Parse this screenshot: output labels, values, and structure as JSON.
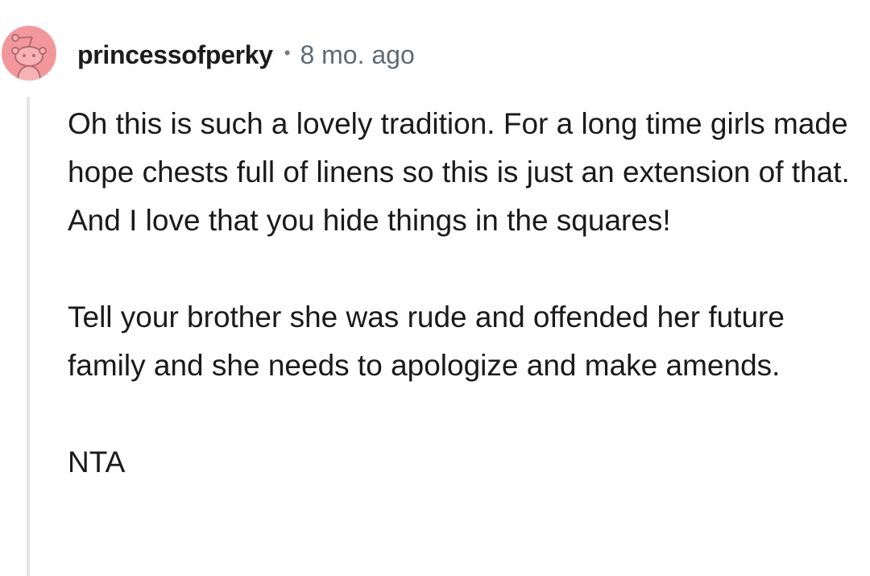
{
  "comment": {
    "author": "princessofperky",
    "separator": "•",
    "timestamp": "8 mo. ago",
    "avatar_icon": "snoo-avatar-icon",
    "colors": {
      "avatar_bg": "#f2989d",
      "thread_line": "#e4e6e8",
      "text": "#1a1a1b",
      "meta": "#5f6b73"
    },
    "paragraphs": [
      "Oh this is such a lovely tradition. For a long time girls made hope chests full of linens so this is just an extension of that. And I love that you hide things in the squares!",
      "Tell your brother she was rude and offended her future family and she needs to apologize and make amends.",
      "NTA"
    ]
  }
}
